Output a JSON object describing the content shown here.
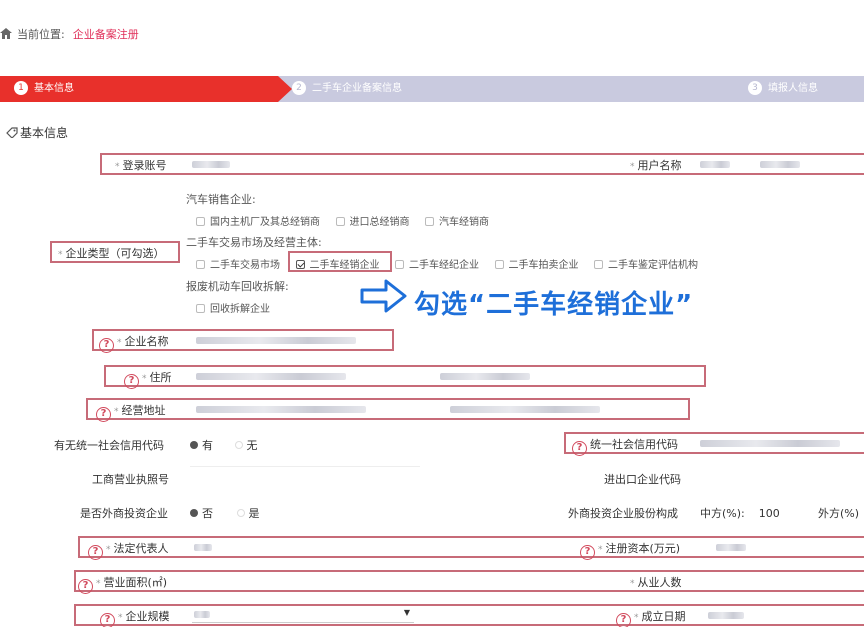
{
  "breadcrumb": {
    "prefix": "当前位置:",
    "current": "企业备案注册"
  },
  "steps": [
    {
      "num": "1",
      "label": "基本信息"
    },
    {
      "num": "2",
      "label": "二手车企业备案信息"
    },
    {
      "num": "3",
      "label": "填报人信息"
    }
  ],
  "section_title": "基本信息",
  "labels": {
    "login_account": "登录账号",
    "user_name": "用户名称",
    "enterprise_type": "企业类型（可勾选）",
    "enterprise_name": "企业名称",
    "residence": "住所",
    "business_address": "经营地址",
    "has_credit_code": "有无统一社会信用代码",
    "credit_code": "统一社会信用代码",
    "business_license": "工商营业执照号",
    "import_export_code": "进出口企业代码",
    "foreign_investment": "是否外商投资企业",
    "foreign_share": "外商投资企业股份构成",
    "legal_rep": "法定代表人",
    "registered_capital": "注册资本(万元)",
    "business_area": "营业面积(㎡)",
    "employees": "从业人数",
    "enterprise_scale": "企业规模",
    "established_date": "成立日期"
  },
  "enterprise_groups": [
    {
      "title": "汽车销售企业:",
      "options": [
        "国内主机厂及其总经销商",
        "进口总经销商",
        "汽车经销商"
      ]
    },
    {
      "title": "二手车交易市场及经营主体:",
      "options": [
        "二手车交易市场",
        "二手车经销企业",
        "二手车经纪企业",
        "二手车拍卖企业",
        "二手车鉴定评估机构"
      ]
    },
    {
      "title": "报废机动车回收拆解:",
      "options": [
        "回收拆解企业"
      ]
    }
  ],
  "credit_code_options": {
    "yes": "有",
    "no": "无"
  },
  "foreign_options": {
    "no": "否",
    "yes": "是"
  },
  "share": {
    "china_label": "中方(%):",
    "china_value": "100",
    "foreign_label": "外方(%)"
  },
  "callout": "勾选“二手车经销企业”",
  "required_mark": "*",
  "help_mark": "?",
  "dropdown_arrow": "▼"
}
